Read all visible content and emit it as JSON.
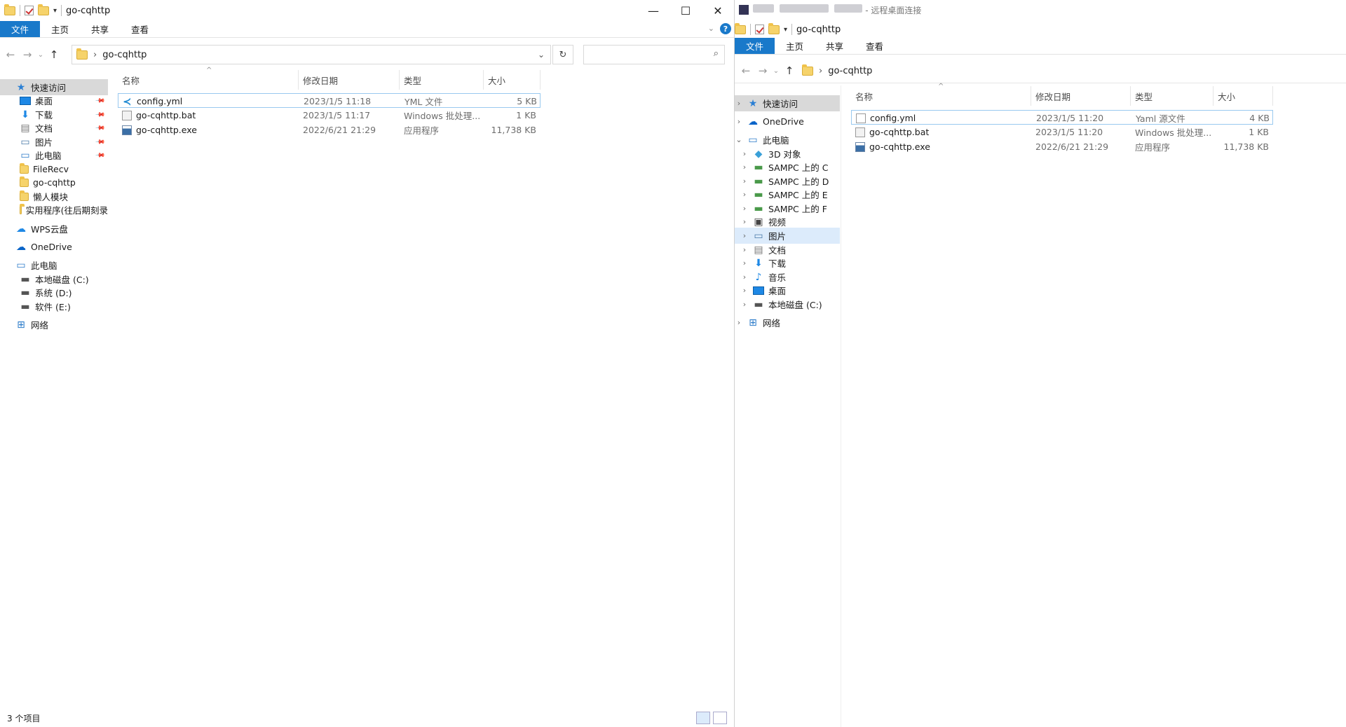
{
  "left": {
    "title": "go-cqhttp",
    "window_controls": [
      "—",
      "☐",
      "✕"
    ],
    "ribbon_tabs": [
      "文件",
      "主页",
      "共享",
      "查看"
    ],
    "address_crumb": "go-cqhttp",
    "search_placeholder": "",
    "nav": [
      {
        "label": "快速访问",
        "icon": "star-icon",
        "pinned": false
      },
      {
        "label": "桌面",
        "icon": "desktop-icon",
        "pinned": true
      },
      {
        "label": "下载",
        "icon": "download-icon",
        "pinned": true
      },
      {
        "label": "文档",
        "icon": "document-icon",
        "pinned": true
      },
      {
        "label": "图片",
        "icon": "picture-icon",
        "pinned": true
      },
      {
        "label": "此电脑",
        "icon": "computer-icon",
        "pinned": true
      },
      {
        "label": "FileRecv",
        "icon": "folder-icon",
        "pinned": false
      },
      {
        "label": "go-cqhttp",
        "icon": "folder-icon",
        "pinned": false
      },
      {
        "label": "懒人模块",
        "icon": "folder-icon",
        "pinned": false
      },
      {
        "label": "实用程序(往后期刻录",
        "icon": "folder-icon",
        "pinned": false
      },
      {
        "label": "WPS云盘",
        "icon": "cloud-icon",
        "pinned": false
      },
      {
        "label": "OneDrive",
        "icon": "onedrive-icon",
        "pinned": false
      },
      {
        "label": "此电脑",
        "icon": "computer-icon",
        "pinned": false
      },
      {
        "label": "本地磁盘 (C:)",
        "icon": "drive-icon",
        "pinned": false
      },
      {
        "label": "系统 (D:)",
        "icon": "drive-icon",
        "pinned": false
      },
      {
        "label": "软件 (E:)",
        "icon": "drive-icon",
        "pinned": false
      },
      {
        "label": "网络",
        "icon": "network-icon",
        "pinned": false
      }
    ],
    "columns": [
      "名称",
      "修改日期",
      "类型",
      "大小"
    ],
    "files": [
      {
        "name": "config.yml",
        "date": "2023/1/5 11:18",
        "type": "YML 文件",
        "size": "5 KB",
        "icon": "vscode-icon"
      },
      {
        "name": "go-cqhttp.bat",
        "date": "2023/1/5 11:17",
        "type": "Windows 批处理...",
        "size": "1 KB",
        "icon": "bat-icon"
      },
      {
        "name": "go-cqhttp.exe",
        "date": "2022/6/21 21:29",
        "type": "应用程序",
        "size": "11,738 KB",
        "icon": "exe-icon"
      }
    ],
    "status": "3 个项目"
  },
  "right": {
    "remote_title": "- 远程桌面连接",
    "title": "go-cqhttp",
    "ribbon_tabs": [
      "文件",
      "主页",
      "共享",
      "查看"
    ],
    "address_crumb": "go-cqhttp",
    "nav": [
      {
        "label": "快速访问",
        "icon": "star-icon",
        "expand": ">"
      },
      {
        "label": "OneDrive",
        "icon": "onedrive-icon",
        "expand": ">"
      },
      {
        "label": "此电脑",
        "icon": "computer-icon",
        "expand": "v"
      },
      {
        "label": "3D 对象",
        "icon": "3d-icon",
        "expand": ">"
      },
      {
        "label": "SAMPC 上的 C",
        "icon": "network-drive-icon",
        "expand": ">"
      },
      {
        "label": "SAMPC 上的 D",
        "icon": "network-drive-icon",
        "expand": ">"
      },
      {
        "label": "SAMPC 上的 E",
        "icon": "network-drive-icon",
        "expand": ">"
      },
      {
        "label": "SAMPC 上的 F",
        "icon": "network-drive-icon",
        "expand": ">"
      },
      {
        "label": "视频",
        "icon": "video-icon",
        "expand": ">"
      },
      {
        "label": "图片",
        "icon": "picture-icon",
        "expand": ">"
      },
      {
        "label": "文档",
        "icon": "document-icon",
        "expand": ">"
      },
      {
        "label": "下载",
        "icon": "download-icon",
        "expand": ">"
      },
      {
        "label": "音乐",
        "icon": "music-icon",
        "expand": ">"
      },
      {
        "label": "桌面",
        "icon": "desktop-icon",
        "expand": ">"
      },
      {
        "label": "本地磁盘 (C:)",
        "icon": "drive-icon",
        "expand": ">"
      },
      {
        "label": "网络",
        "icon": "network-icon",
        "expand": ">"
      }
    ],
    "columns": [
      "名称",
      "修改日期",
      "类型",
      "大小"
    ],
    "files": [
      {
        "name": "config.yml",
        "date": "2023/1/5 11:20",
        "type": "Yaml 源文件",
        "size": "4 KB",
        "icon": "yaml-icon"
      },
      {
        "name": "go-cqhttp.bat",
        "date": "2023/1/5 11:20",
        "type": "Windows 批处理...",
        "size": "1 KB",
        "icon": "bat-icon"
      },
      {
        "name": "go-cqhttp.exe",
        "date": "2022/6/21 21:29",
        "type": "应用程序",
        "size": "11,738 KB",
        "icon": "exe-icon"
      }
    ]
  }
}
